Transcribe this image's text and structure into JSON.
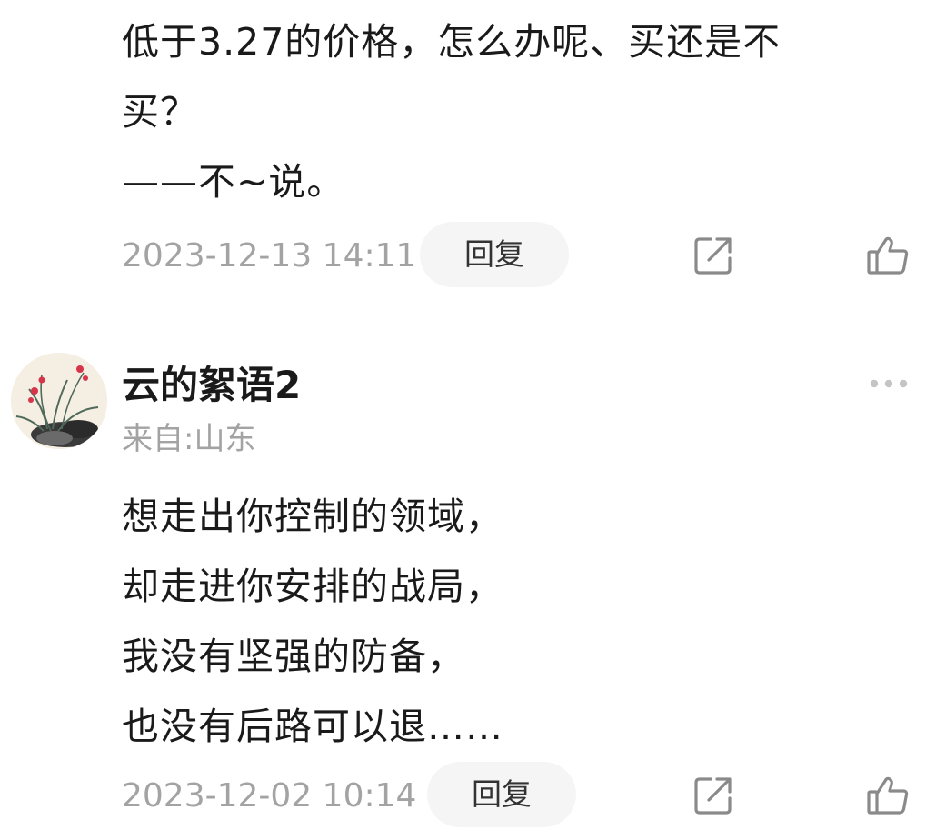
{
  "comment_1": {
    "body_lines": [
      "低于3.27的价格，怎么办呢、买还是不",
      "买？",
      "——不~说。"
    ],
    "timestamp": "2023-12-13 14:11",
    "reply_label": "回复"
  },
  "comment_2": {
    "author_name": "云的絮语2",
    "author_location": "来自:山东",
    "body_lines": [
      "想走出你控制的领域，",
      "却走进你安排的战局，",
      "我没有坚强的防备，",
      "也没有后路可以退……"
    ],
    "timestamp": "2023-12-02 10:14",
    "reply_label": "回复"
  },
  "icons": {
    "share": "share-icon",
    "like": "thumbs-up-icon",
    "more": "more-options-icon",
    "avatar": "orchid-painting-avatar"
  },
  "colors": {
    "text_primary": "#1a1a1a",
    "text_secondary": "#a3a3a3",
    "reply_bg": "#f5f5f5",
    "icon_stroke": "#8a8a8a"
  }
}
